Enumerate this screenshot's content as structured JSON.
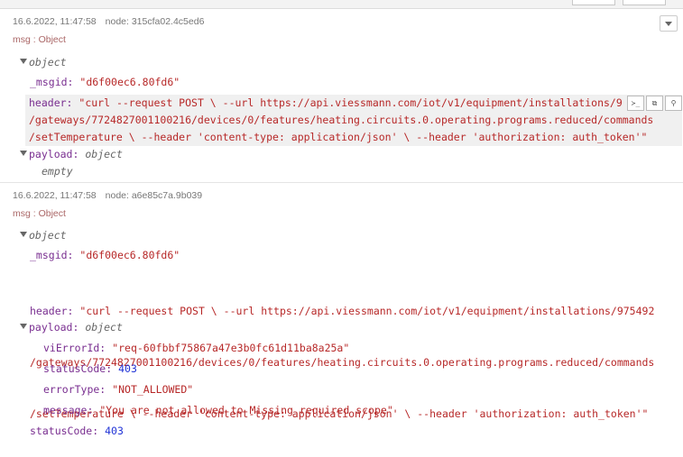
{
  "messages": [
    {
      "timestamp": "16.6.2022, 11:47:58",
      "node_label": "node:",
      "node_id": "315cfa02.4c5ed6",
      "msg_type": "msg : Object",
      "root_label": "object",
      "msgid_key": "_msgid:",
      "msgid_value": "\"d6f00ec6.80fd6\"",
      "header_key": "header:",
      "header_lines": [
        "\"curl --request POST \\ --url https://api.viessmann.com/iot/v1/equipment/installations/9",
        "/gateways/7724827001100216/devices/0/features/heating.circuits.0.operating.programs.reduced/commands",
        "/setTemperature \\ --header 'content-type: application/json' \\ --header 'authorization: auth_token'\""
      ],
      "payload_key": "payload:",
      "payload_type": "object",
      "payload_empty": "empty"
    },
    {
      "timestamp": "16.6.2022, 11:47:58",
      "node_label": "node:",
      "node_id": "a6e85c7a.9b039",
      "msg_type": "msg : Object",
      "root_label": "object",
      "msgid_key": "_msgid:",
      "msgid_value": "\"d6f00ec6.80fd6\"",
      "header_key": "header:",
      "header_lines": [
        "\"curl --request POST \\ --url https://api.viessmann.com/iot/v1/equipment/installations/975492",
        "/gateways/7724827001100216/devices/0/features/heating.circuits.0.operating.programs.reduced/commands",
        "/setTemperature \\ --header 'content-type: application/json' \\ --header 'authorization: auth_token'\""
      ],
      "payload_key": "payload:",
      "payload_type": "object",
      "payload_fields": [
        {
          "key": "viErrorId:",
          "value": "\"req-60fbbf75867a47e3b0fc61d11ba8a25a\"",
          "kind": "str"
        },
        {
          "key": "statusCode:",
          "value": "403",
          "kind": "num"
        },
        {
          "key": "errorType:",
          "value": "\"NOT_ALLOWED\"",
          "kind": "str"
        },
        {
          "key": "message:",
          "value": "\"You are not allowed to Missing required scope\"",
          "kind": "str"
        }
      ],
      "status_key": "statusCode:",
      "status_value": "403"
    }
  ],
  "tools": {
    "copy_path": "≻_",
    "copy_value": "⧉",
    "pin": "⚲"
  },
  "colors": {
    "key": "#792e90",
    "string": "#b72828",
    "number": "#2033d6"
  }
}
